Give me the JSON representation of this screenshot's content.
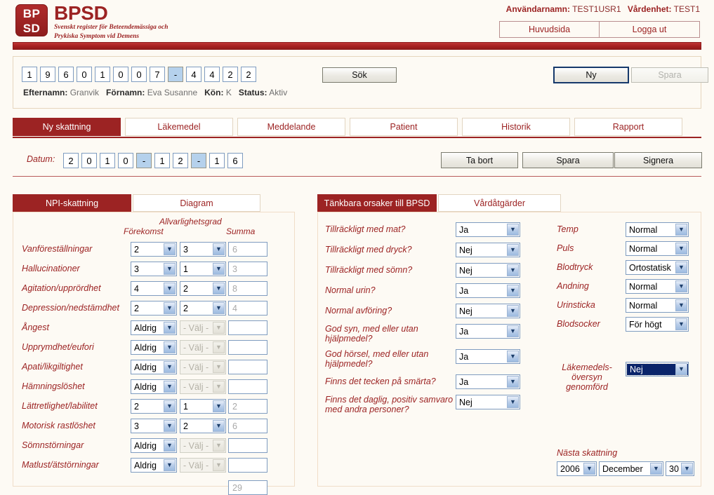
{
  "header": {
    "logo_mark_line1": "BP",
    "logo_mark_line2": "SD",
    "logo_title": "BPSD",
    "logo_sub_line1": "Svenskt register för Beteendemässiga och",
    "logo_sub_line2": "Prykiska Symptom vid Demens",
    "username_label": "Användarnamn:",
    "username_value": "TEST1USR1",
    "unit_label": "Vårdenhet:",
    "unit_value": "TEST1",
    "buttons": [
      {
        "label": "Huvudsida",
        "name": "huvudsida-button"
      },
      {
        "label": "Logga ut",
        "name": "logga-ut-button"
      }
    ]
  },
  "search": {
    "personal_number": [
      "1",
      "9",
      "6",
      "0",
      "1",
      "0",
      "0",
      "7",
      "-",
      "4",
      "4",
      "2",
      "2"
    ],
    "separator_index": 8,
    "sok_label": "Sök",
    "ny_label": "Ny",
    "spara_label": "Spara",
    "patient": {
      "lastname_label": "Efternamn:",
      "lastname_value": "Granvik",
      "firstname_label": "Förnamn:",
      "firstname_value": "Eva Susanne",
      "gender_label": "Kön:",
      "gender_value": "K",
      "status_label": "Status:",
      "status_value": "Aktiv"
    }
  },
  "tabs": [
    {
      "label": "Ny skattning",
      "active": true
    },
    {
      "label": "Läkemedel",
      "active": false
    },
    {
      "label": "Meddelande",
      "active": false
    },
    {
      "label": "Patient",
      "active": false
    },
    {
      "label": "Historik",
      "active": false
    },
    {
      "label": "Rapport",
      "active": false
    }
  ],
  "date_row": {
    "label": "Datum:",
    "digits": [
      "2",
      "0",
      "1",
      "0",
      "-",
      "1",
      "2",
      "-",
      "1",
      "6"
    ],
    "separator_indexes": [
      4,
      7
    ],
    "buttons": [
      {
        "label": "Ta bort",
        "name": "ta-bort-button"
      },
      {
        "label": "Spara",
        "name": "spara-button"
      },
      {
        "label": "Signera",
        "name": "signera-button"
      }
    ]
  },
  "left_panel": {
    "subtabs": [
      {
        "label": "NPI-skattning",
        "active": true
      },
      {
        "label": "Diagram",
        "active": false
      }
    ],
    "col_headers": {
      "severity": "Allvarlighetsgrad",
      "occurrence": "Förekomst",
      "sum": "Summa"
    },
    "rows": [
      {
        "label": "Vanföreställningar",
        "occurrence": "2",
        "severity": "3",
        "sum": "6",
        "disabled": false
      },
      {
        "label": "Hallucinationer",
        "occurrence": "3",
        "severity": "1",
        "sum": "3",
        "disabled": false
      },
      {
        "label": "Agitation/upprördhet",
        "occurrence": "4",
        "severity": "2",
        "sum": "8",
        "disabled": false
      },
      {
        "label": "Depression/nedstämdhet",
        "occurrence": "2",
        "severity": "2",
        "sum": "4",
        "disabled": false
      },
      {
        "label": "Ångest",
        "occurrence": "Aldrig",
        "severity": "- Välj -",
        "sum": "",
        "disabled": true
      },
      {
        "label": "Upprymdhet/eufori",
        "occurrence": "Aldrig",
        "severity": "- Välj -",
        "sum": "",
        "disabled": true
      },
      {
        "label": "Apati/likgiltighet",
        "occurrence": "Aldrig",
        "severity": "- Välj -",
        "sum": "",
        "disabled": true
      },
      {
        "label": "Hämningslöshet",
        "occurrence": "Aldrig",
        "severity": "- Välj -",
        "sum": "",
        "disabled": true
      },
      {
        "label": "Lättretlighet/labilitet",
        "occurrence": "2",
        "severity": "1",
        "sum": "2",
        "disabled": false
      },
      {
        "label": "Motorisk rastlöshet",
        "occurrence": "3",
        "severity": "2",
        "sum": "6",
        "disabled": false
      },
      {
        "label": "Sömnstörningar",
        "occurrence": "Aldrig",
        "severity": "- Välj -",
        "sum": "",
        "disabled": true
      },
      {
        "label": "Matlust/ätstörningar",
        "occurrence": "Aldrig",
        "severity": "- Välj -",
        "sum": "",
        "disabled": true
      }
    ],
    "total_sum": "29"
  },
  "right_panel": {
    "subtabs": [
      {
        "label": "Tänkbara orsaker till BPSD",
        "active": true
      },
      {
        "label": "Vårdåtgärder",
        "active": false
      }
    ],
    "questions": [
      {
        "label": "Tillräckligt med mat?",
        "value": "Ja",
        "lines": 1
      },
      {
        "label": "Tillräckligt med dryck?",
        "value": "Nej",
        "lines": 1
      },
      {
        "label": "Tillräckligt med sömn?",
        "value": "Nej",
        "lines": 1
      },
      {
        "label": "Normal urin?",
        "value": "Ja",
        "lines": 1
      },
      {
        "label": "Normal avföring?",
        "value": "Nej",
        "lines": 1
      },
      {
        "label": "God syn, med eller utan hjälpmedel?",
        "value": "Ja",
        "lines": 2
      },
      {
        "label": "God hörsel, med eller utan hjälpmedel?",
        "value": "Ja",
        "lines": 2
      },
      {
        "label": "Finns det tecken på smärta?",
        "value": "Ja",
        "lines": 1
      },
      {
        "label": "Finns det daglig, positiv samvaro med andra personer?",
        "value": "Nej",
        "lines": 2
      }
    ],
    "vitals": [
      {
        "label": "Temp",
        "value": "Normal",
        "focused": false
      },
      {
        "label": "Puls",
        "value": "Normal",
        "focused": false
      },
      {
        "label": "Blodtryck",
        "value": "Ortostatisk",
        "focused": false
      },
      {
        "label": "Andning",
        "value": "Normal",
        "focused": false
      },
      {
        "label": "Urinsticka",
        "value": "Normal",
        "focused": false
      },
      {
        "label": "Blodsocker",
        "value": "För högt",
        "focused": false
      }
    ],
    "medication_review": {
      "label_line1": "Läkemedels-",
      "label_line2": "översyn",
      "label_line3": "genomförd",
      "value": "Nej",
      "focused": true
    },
    "next_assessment": {
      "label": "Nästa skattning",
      "year": "2006",
      "month": "December",
      "day": "30"
    }
  },
  "colors": {
    "brand_red": "#9c2323",
    "page_bg": "#fdfaf4",
    "panel_border": "#e6d6bd",
    "select_border": "#7f9cc0",
    "focus_blue": "#0a246a"
  },
  "icons": {
    "chevron_down": "▼"
  }
}
